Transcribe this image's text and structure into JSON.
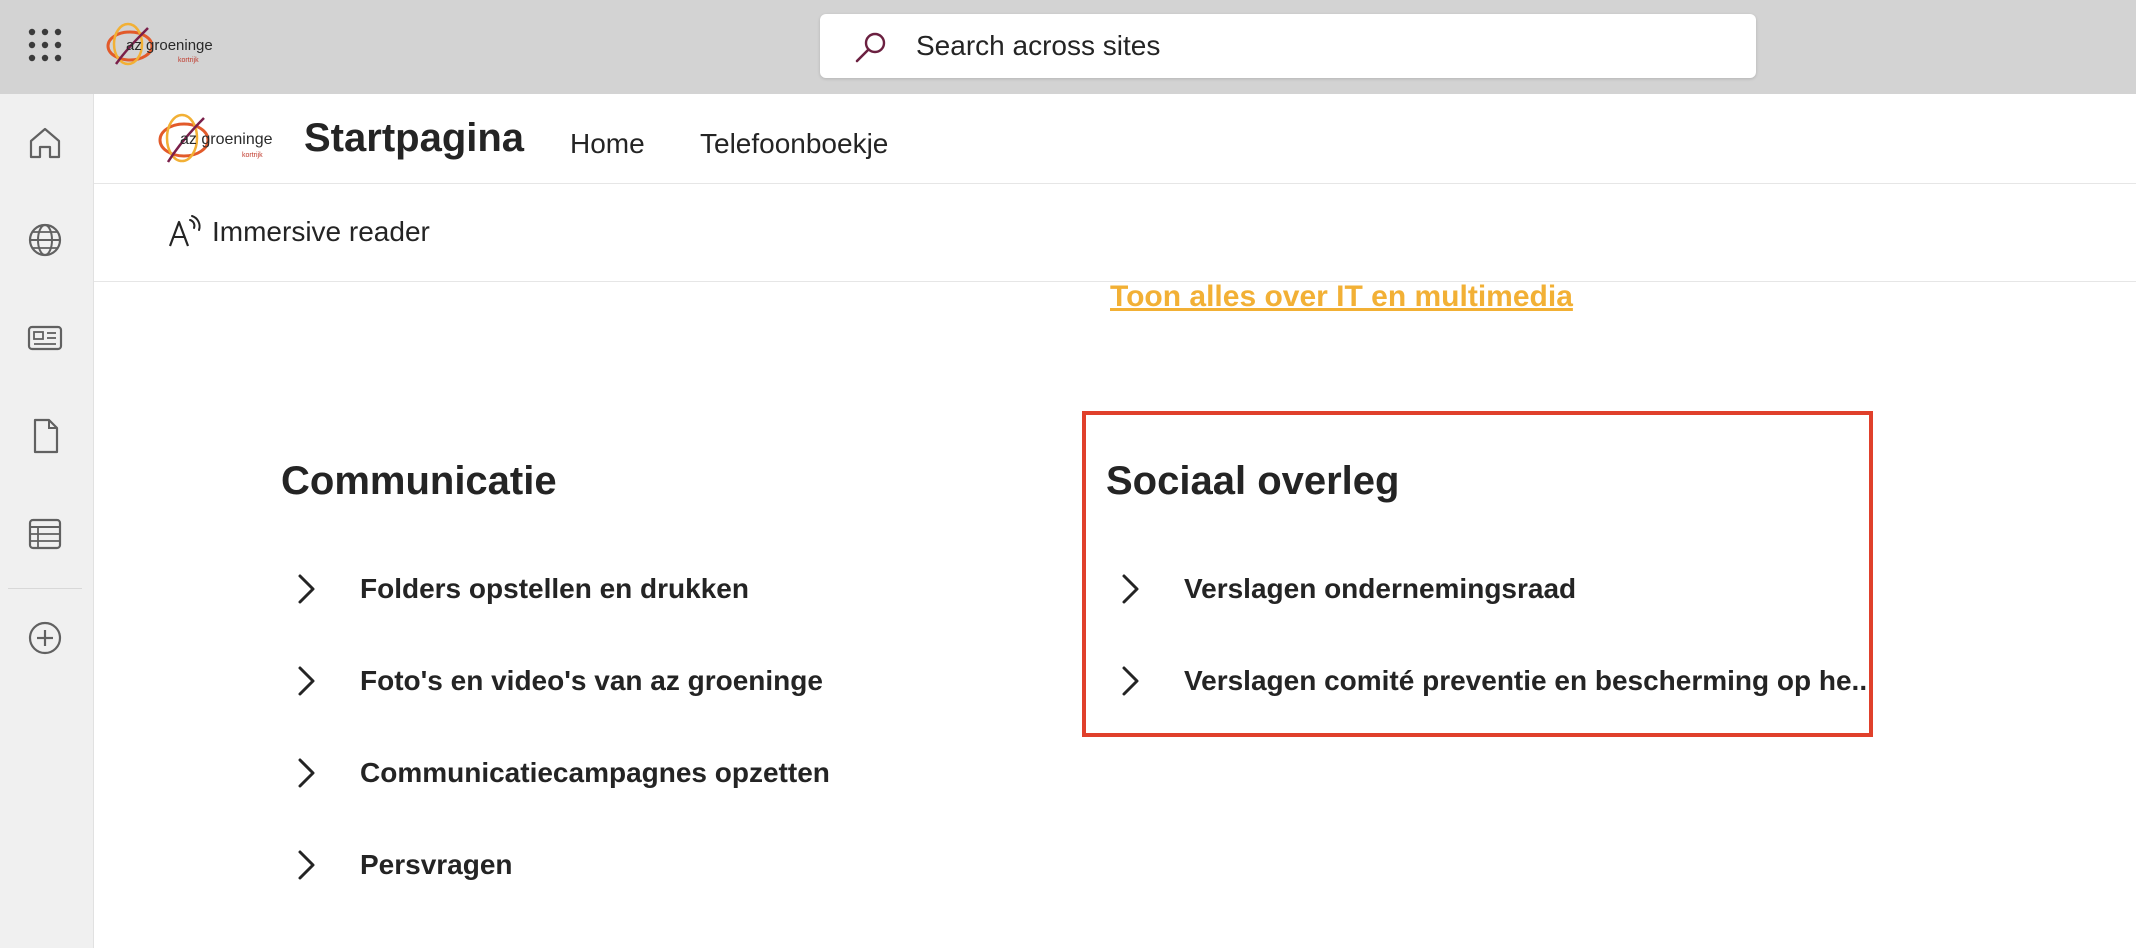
{
  "suitebar": {
    "search_placeholder": "Search across sites"
  },
  "appbar": {
    "icons": [
      "home-icon",
      "globe-icon",
      "news-icon",
      "document-icon",
      "list-icon",
      "add-circle-icon"
    ]
  },
  "site": {
    "title": "Startpagina",
    "nav": [
      {
        "label": "Home"
      },
      {
        "label": "Telefoonboekje"
      }
    ]
  },
  "command_bar": {
    "immersive_reader": "Immersive reader"
  },
  "content": {
    "show_all_link": "Toon alles over IT en multimedia",
    "sections": [
      {
        "title": "Communicatie",
        "links": [
          {
            "label": "Folders opstellen en drukken"
          },
          {
            "label": "Foto's en video's van az groeninge"
          },
          {
            "label": "Communicatiecampagnes opzetten"
          },
          {
            "label": "Persvragen"
          }
        ]
      },
      {
        "title": "Sociaal overleg",
        "links": [
          {
            "label": "Verslagen ondernemingsraad"
          },
          {
            "label": "Verslagen comité preventie en bescherming op he..."
          }
        ]
      }
    ]
  },
  "colors": {
    "suitebar_bg": "#d3d3d3",
    "accent_link": "#f2b035",
    "highlight_border": "#e0402b",
    "text": "#242424"
  }
}
